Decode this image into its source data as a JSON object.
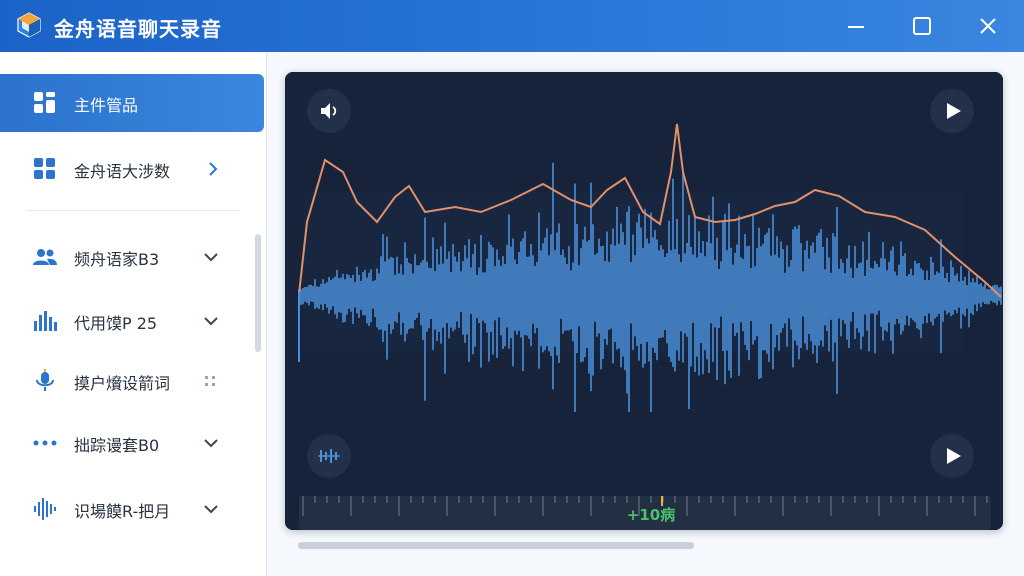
{
  "app": {
    "title": "金舟语音聊天录音",
    "logo_icon": "app-logo-icon"
  },
  "window_controls": {
    "minimize_icon": "minimize-icon",
    "maximize_icon": "maximize-icon",
    "close_icon": "close-icon"
  },
  "sidebar": {
    "items": [
      {
        "label": "主件管品",
        "icon": "grid-icon",
        "active": true,
        "trailing": ""
      },
      {
        "label": "金舟语大涉数",
        "icon": "grid-icon",
        "active": false,
        "trailing": "chevron-right"
      },
      {
        "label": "频舟语家B3",
        "icon": "users-icon",
        "active": false,
        "trailing": "chevron-down"
      },
      {
        "label": "代用馍P 25",
        "icon": "bars-chart-icon",
        "active": false,
        "trailing": "chevron-down"
      },
      {
        "label": "摸户燲设箭词",
        "icon": "microphone-icon",
        "active": false,
        "trailing": "dots-icon"
      },
      {
        "label": "拙踪谩套B0",
        "icon": "dots-icon",
        "active": false,
        "trailing": "chevron-down"
      },
      {
        "label": "识場饃R-把月",
        "icon": "waveform-icon",
        "active": false,
        "trailing": "chevron-down"
      }
    ]
  },
  "player": {
    "volume_icon": "volume-icon",
    "equalizer_icon": "equalizer-icon",
    "play_icon": "play-icon",
    "time_marker": "+10病",
    "colors": {
      "background": "#16233a",
      "waveform": "#4a90d9",
      "pitch_curve": "#e0906a",
      "time_label": "#47c06b",
      "playhead": "#e0b43a"
    }
  }
}
